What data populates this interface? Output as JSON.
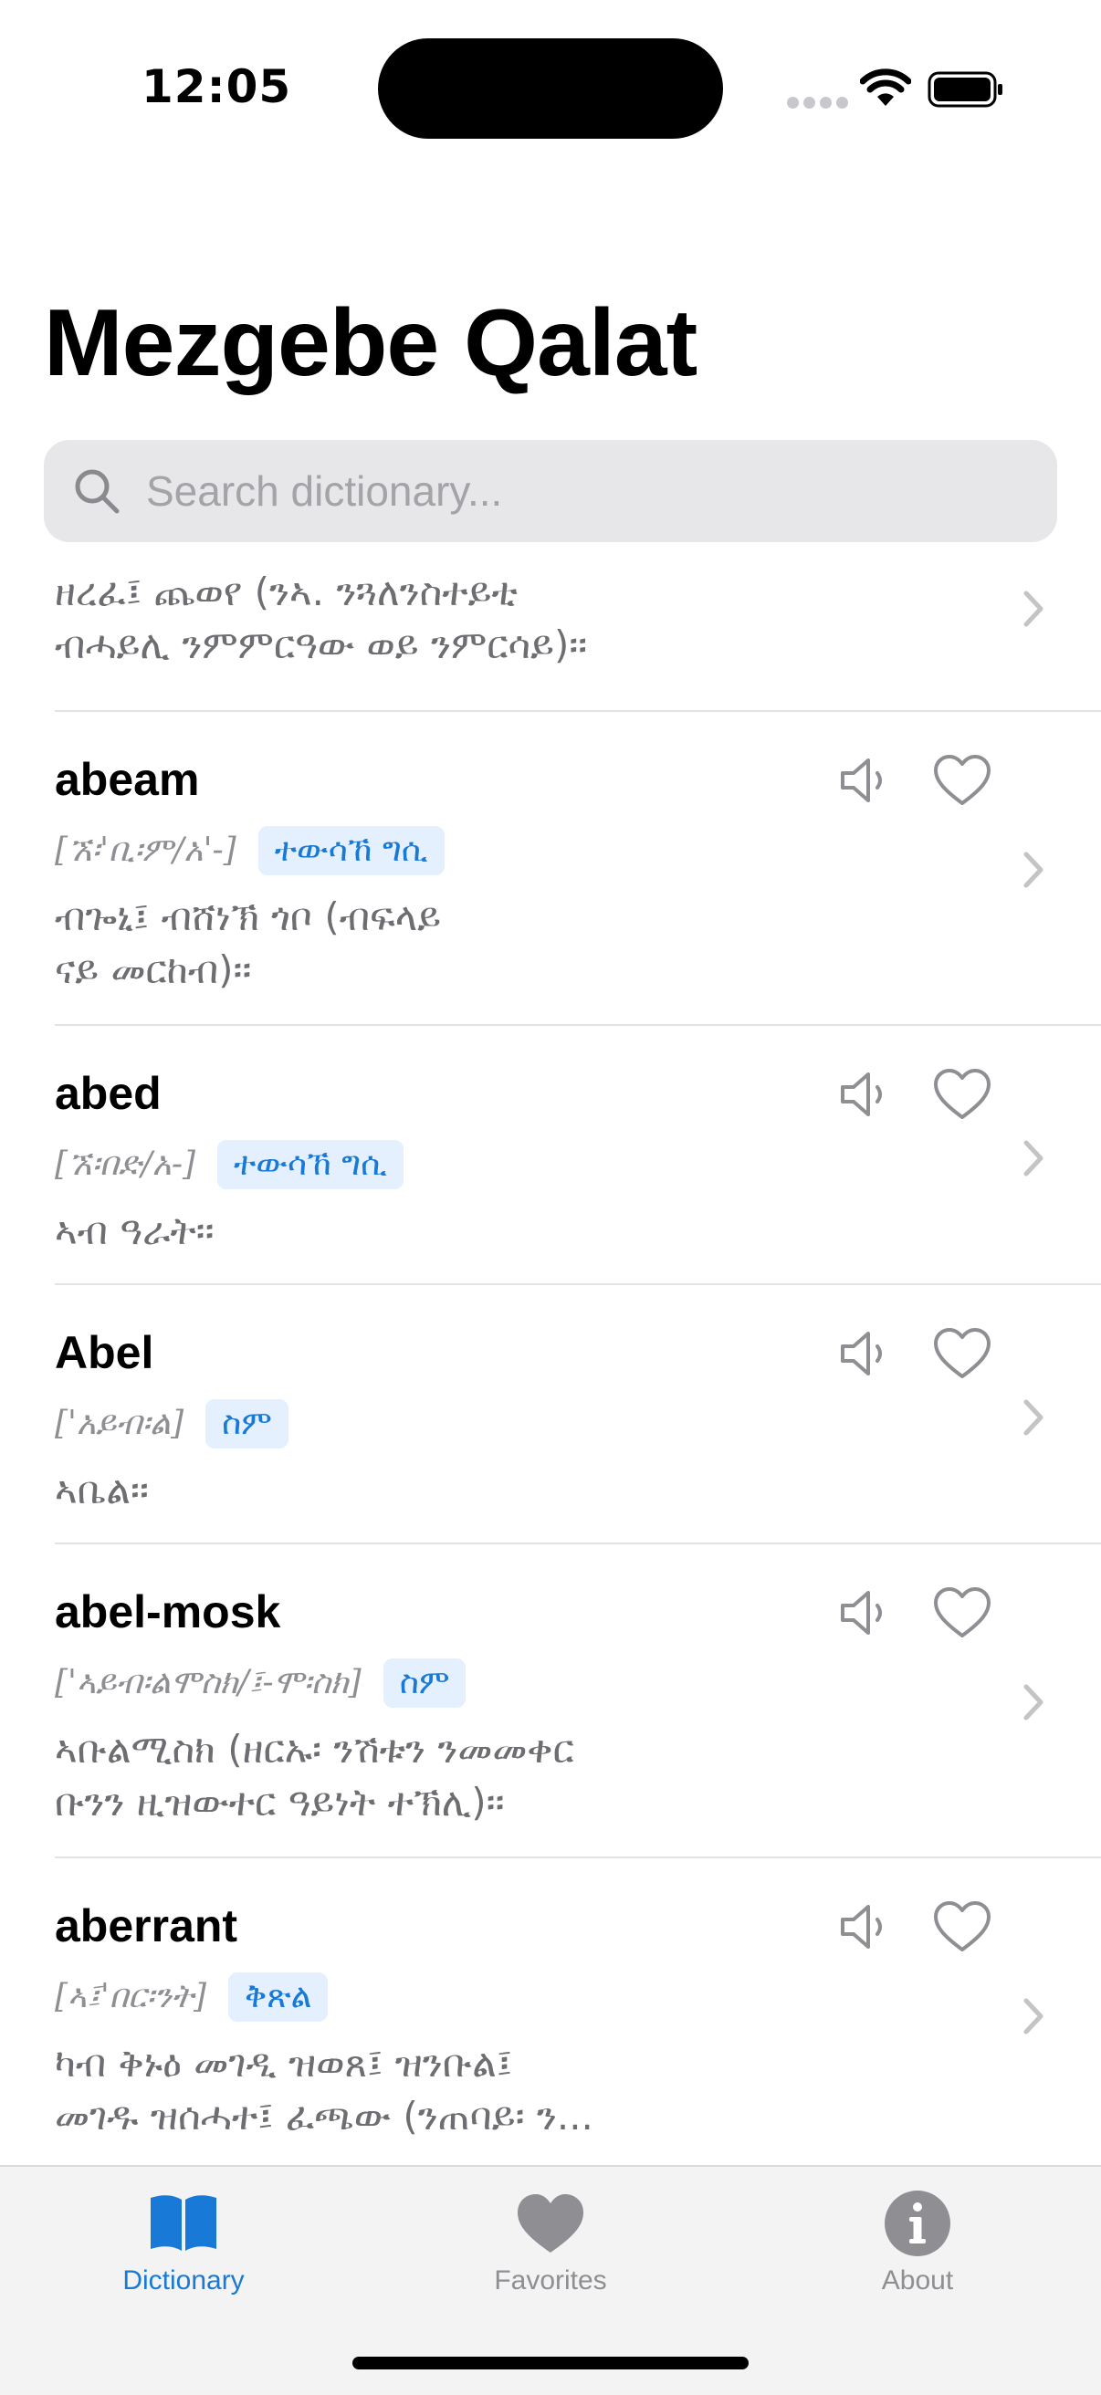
{
  "status_bar": {
    "time": "12:05"
  },
  "title": "Mezgebe Qalat",
  "search": {
    "placeholder": "Search dictionary..."
  },
  "colors": {
    "accent": "#1979d6",
    "badge_bg": "#e4f0fd",
    "inactive": "#8e8e93"
  },
  "entries": [
    {
      "word": "",
      "pronunciation": "",
      "pos": "",
      "definition": [
        "ዘረፈ፤ ጨወየ (ንኣ. ንጓለንስተይቲ",
        "ብሓይሊ ንምምርዓው ወይ ንምርሳይ)፡፡"
      ]
    },
    {
      "word": "abeam",
      "pronunciation": "[ኧ፡'ቢ፡ም/አ'-]",
      "pos": "ተውሳኸ ግሲ",
      "definition": [
        "ብጐኒ፤ ብሸነኽ ጎቦ (ብፍላይ",
        "ናይ መርከብ)፡፡"
      ]
    },
    {
      "word": "abed",
      "pronunciation": "[ኧ፡በድ/አ-]",
      "pos": "ተውሳኸ ግሲ",
      "definition": [
        "ኣብ ዓራት፡፡"
      ]
    },
    {
      "word": "Abel",
      "pronunciation": "['አይብ፡ል]",
      "pos": "ስም",
      "definition": [
        "ኣቤል፡፡"
      ]
    },
    {
      "word": "abel-mosk",
      "pronunciation": "['ኣይብ፡ልሞስክ/፤-ሞ፡ስክ]",
      "pos": "ስም",
      "definition": [
        "ኣቡልሚስክ (ዘርኡ፡ ንሽቱን ንመመቀር",
        "ቡንን ዚዝውተር ዓይነት ተኽሊ)፡፡"
      ]
    },
    {
      "word": "aberrant",
      "pronunciation": "[ኣ፤'በር፡ንት]",
      "pos": "ቅጽል",
      "definition": [
        "ካብ ቅኑዕ መገዲ ዝወጸ፤ ዝንቡል፤",
        "መገዱ ዝሰሓተ፤ ፈጫው (ንጠባይ፡ ን..."
      ]
    }
  ],
  "tab_bar": {
    "tabs": [
      {
        "label": "Dictionary",
        "icon": "book-icon",
        "active": true
      },
      {
        "label": "Favorites",
        "icon": "heart-icon",
        "active": false
      },
      {
        "label": "About",
        "icon": "info-icon",
        "active": false
      }
    ]
  }
}
